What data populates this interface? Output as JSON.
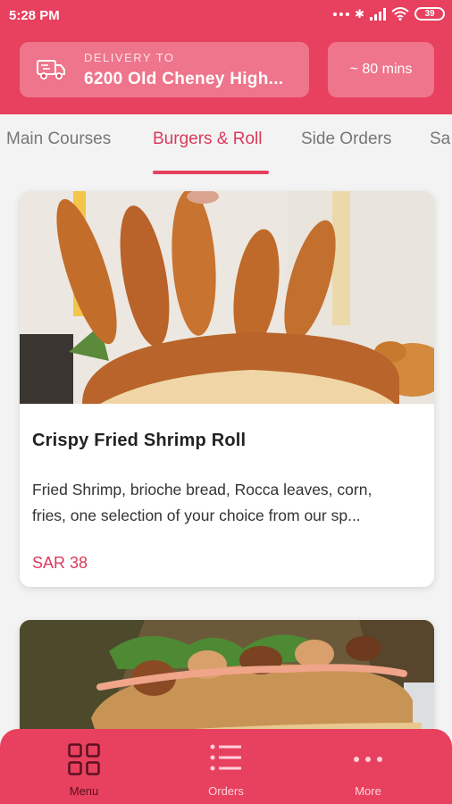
{
  "status_bar": {
    "time": "5:28 PM",
    "battery": "39"
  },
  "header": {
    "delivery_label": "DELIVERY TO",
    "delivery_address": "6200 Old Cheney High...",
    "eta": "~ 80 mins"
  },
  "tabs": [
    {
      "label": "Main Courses"
    },
    {
      "label": "Burgers & Roll"
    },
    {
      "label": "Side Orders"
    },
    {
      "label": "Sa"
    }
  ],
  "active_tab": "Burgers & Roll",
  "items": [
    {
      "title": "Crispy Fried Shrimp Roll",
      "desc_line1": "Fried Shrimp, brioche bread, Rocca leaves, corn,",
      "desc_line2": "fries, one selection of your choice from our sp...",
      "price": "SAR 38"
    }
  ],
  "bottom_nav": [
    {
      "label": "Menu",
      "icon": "grid-icon"
    },
    {
      "label": "Orders",
      "icon": "list-icon"
    },
    {
      "label": "More",
      "icon": "more-dots-icon"
    }
  ],
  "colors": {
    "brand": "#e8405f",
    "price": "#d93a5b"
  }
}
